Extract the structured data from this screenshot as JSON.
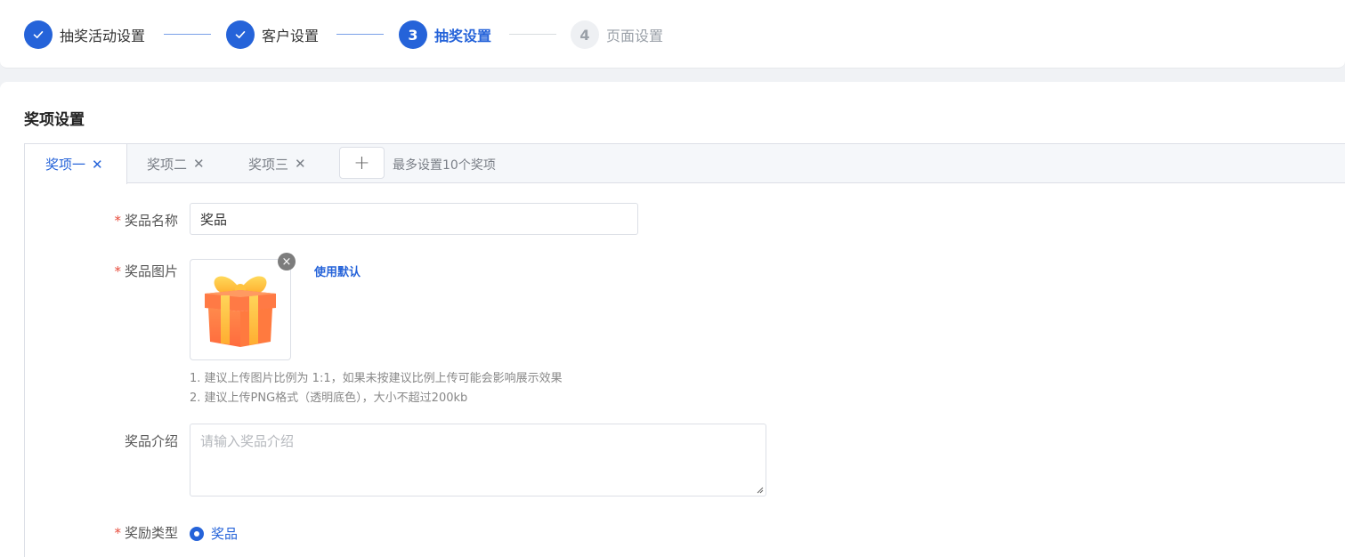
{
  "steps": [
    {
      "label": "抽奖活动设置",
      "state": "done",
      "number": "1"
    },
    {
      "label": "客户设置",
      "state": "done",
      "number": "2"
    },
    {
      "label": "抽奖设置",
      "state": "active",
      "number": "3"
    },
    {
      "label": "页面设置",
      "state": "pending",
      "number": "4"
    }
  ],
  "section": {
    "title": "奖项设置"
  },
  "tabs": [
    {
      "label": "奖项一",
      "close": "✕",
      "active": true
    },
    {
      "label": "奖项二",
      "close": "✕",
      "active": false
    },
    {
      "label": "奖项三",
      "close": "✕",
      "active": false
    }
  ],
  "add_tab": {
    "label": "+"
  },
  "tab_hint": "最多设置10个奖项",
  "form": {
    "required_mark": "*",
    "prize_name": {
      "label": "奖品名称",
      "value": "奖品"
    },
    "prize_image": {
      "label": "奖品图片",
      "remove": "×",
      "use_default": "使用默认",
      "tips": [
        "1. 建议上传图片比例为 1:1，如果未按建议比例上传可能会影响展示效果",
        "2. 建议上传PNG格式（透明底色），大小不超过200kb"
      ]
    },
    "prize_intro": {
      "label": "奖品介绍",
      "placeholder": "请输入奖品介绍"
    },
    "reward_type": {
      "label": "奖励类型",
      "option": "奖品"
    }
  },
  "colors": {
    "accent": "#2563d9",
    "required": "#e74c3c"
  },
  "icons": {
    "check": "check-icon",
    "gift": "gift-icon"
  }
}
